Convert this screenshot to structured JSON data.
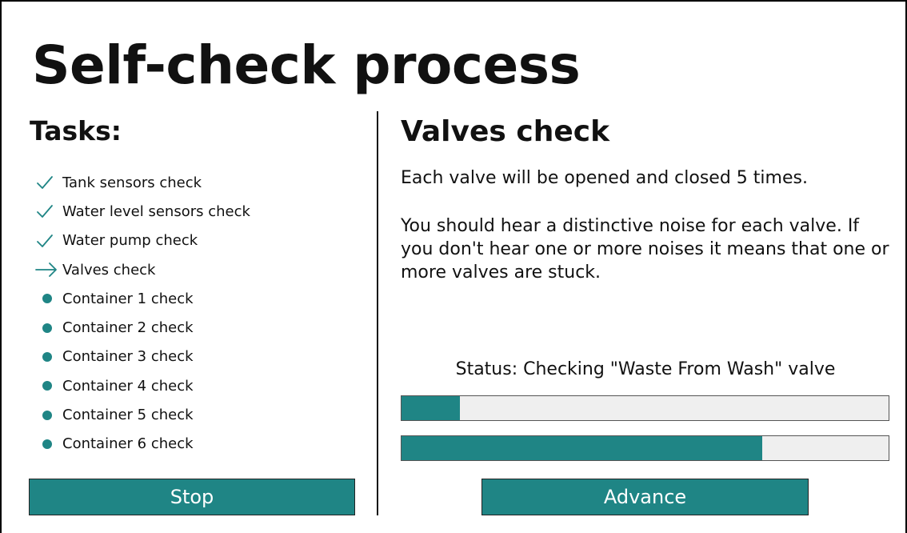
{
  "page": {
    "title": "Self-check process"
  },
  "tasks": {
    "heading": "Tasks:",
    "items": [
      {
        "label": "Tank sensors check",
        "state": "done",
        "icon": "checkmark-icon"
      },
      {
        "label": "Water level sensors check",
        "state": "done",
        "icon": "checkmark-icon"
      },
      {
        "label": "Water pump check",
        "state": "done",
        "icon": "checkmark-icon"
      },
      {
        "label": "Valves check",
        "state": "current",
        "icon": "arrow-right-icon"
      },
      {
        "label": "Container 1 check",
        "state": "pending",
        "icon": "bullet-icon"
      },
      {
        "label": "Container 2 check",
        "state": "pending",
        "icon": "bullet-icon"
      },
      {
        "label": "Container 3 check",
        "state": "pending",
        "icon": "bullet-icon"
      },
      {
        "label": "Container 4 check",
        "state": "pending",
        "icon": "bullet-icon"
      },
      {
        "label": "Container 5 check",
        "state": "pending",
        "icon": "bullet-icon"
      },
      {
        "label": "Container 6 check",
        "state": "pending",
        "icon": "bullet-icon"
      }
    ]
  },
  "current_step": {
    "title": "Valves check",
    "description_1": "Each valve will be opened and closed 5 times.",
    "description_2": "You should hear a distinctive noise for each valve. If you don't hear one or more noises it means that one or more valves are stuck.",
    "status": "Status: Checking \"Waste From Wash\" valve",
    "progress_step": 0.12,
    "progress_overall": 0.74
  },
  "buttons": {
    "stop_label": "Stop",
    "advance_label": "Advance"
  },
  "colors": {
    "accent": "#1f8585",
    "track": "#efefef"
  }
}
